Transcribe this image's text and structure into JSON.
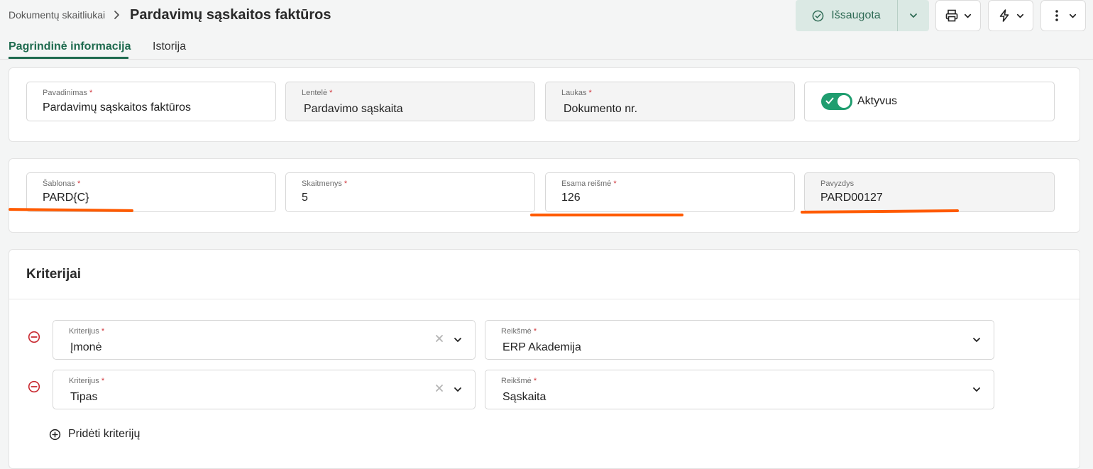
{
  "header": {
    "breadcrumb_parent": "Dokumentų skaitliukai",
    "title": "Pardavimų sąskaitos faktūros",
    "save_label": "Išsaugota"
  },
  "tabs": [
    {
      "label": "Pagrindinė informacija",
      "active": true
    },
    {
      "label": "Istorija",
      "active": false
    }
  ],
  "general": {
    "name": {
      "label": "Pavadinimas",
      "value": "Pardavimų sąskaitos faktūros"
    },
    "table": {
      "label": "Lentelė",
      "value": "Pardavimo sąskaita"
    },
    "field": {
      "label": "Laukas",
      "value": "Dokumento nr."
    },
    "active": {
      "label": "Aktyvus",
      "on": true
    }
  },
  "numbering": {
    "template": {
      "label": "Šablonas",
      "value": "PARD{C}"
    },
    "digits": {
      "label": "Skaitmenys",
      "value": "5"
    },
    "current": {
      "label": "Esama reišmė",
      "value": "126"
    },
    "example": {
      "label": "Pavyzdys",
      "value": "PARD00127"
    }
  },
  "criteria": {
    "title": "Kriterijai",
    "rows": [
      {
        "criterion_label": "Kriterijus",
        "criterion": "Įmonė",
        "value_label": "Reikšmė",
        "value": "ERP Akademija"
      },
      {
        "criterion_label": "Kriterijus",
        "criterion": "Tipas",
        "value_label": "Reikšmė",
        "value": "Sąskaita"
      }
    ],
    "add_label": "Pridėti kriterijų"
  },
  "required_mark": "*",
  "colors": {
    "accent": "#1f6b4f",
    "toggle": "#1f9d6f",
    "highlight": "#ff5a00",
    "danger": "#c8282f"
  }
}
